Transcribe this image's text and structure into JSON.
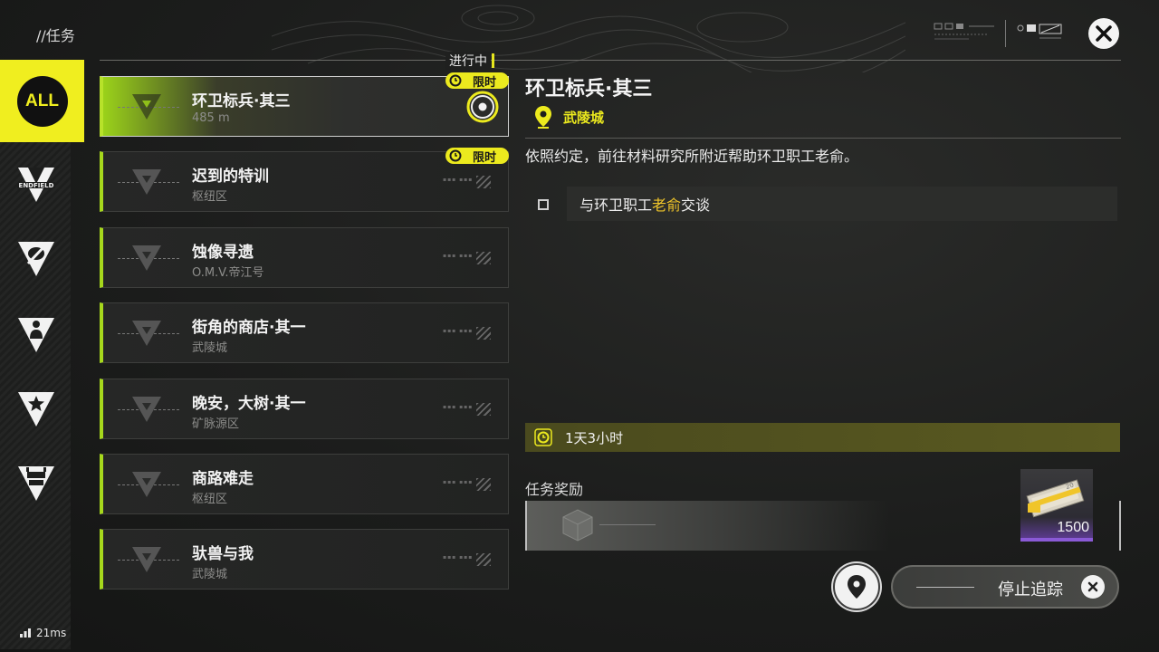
{
  "header": {
    "breadcrumb": "//任务",
    "status_tag": "进行中",
    "close_icon": "close-x-icon"
  },
  "sidenav": {
    "all_label": "ALL",
    "items": [
      {
        "icon": "endfield-icon",
        "label": "ENDFIELD"
      },
      {
        "icon": "eye-slash-icon"
      },
      {
        "icon": "person-icon"
      },
      {
        "icon": "star-icon"
      },
      {
        "icon": "crate-icon"
      }
    ]
  },
  "quests": [
    {
      "title": "环卫标兵·其三",
      "subtitle": "485 m",
      "active": true,
      "limited": true
    },
    {
      "title": "迟到的特训",
      "subtitle": "枢纽区",
      "active": false,
      "limited": true
    },
    {
      "title": "蚀像寻遗",
      "subtitle": "O.M.V.帝江号",
      "active": false,
      "limited": false
    },
    {
      "title": "街角的商店·其一",
      "subtitle": "武陵城",
      "active": false,
      "limited": false
    },
    {
      "title": "晚安，大树·其一",
      "subtitle": "矿脉源区",
      "active": false,
      "limited": false
    },
    {
      "title": "商路难走",
      "subtitle": "枢纽区",
      "active": false,
      "limited": false
    },
    {
      "title": "驮兽与我",
      "subtitle": "武陵城",
      "active": false,
      "limited": false
    }
  ],
  "limited_label": "限时",
  "detail": {
    "title": "环卫标兵·其三",
    "location": "武陵城",
    "description": "依照约定，前往材料研究所附近帮助环卫职工老俞。",
    "objective": {
      "prefix": "与环卫职工",
      "highlight": "老俞",
      "suffix": "交谈"
    },
    "time_remaining": "1天3小时",
    "reward_label": "任务奖励",
    "reward_item": {
      "quantity": "1500",
      "icon": "cash-bundle-icon"
    }
  },
  "actions": {
    "map_icon": "map-pin-icon",
    "stop_tracking": "停止追踪"
  },
  "network": {
    "latency": "21ms"
  },
  "colors": {
    "accent": "#ecea1e",
    "green": "#a6d81c",
    "highlight": "#f0c52a",
    "purple": "#8a5ad6"
  }
}
